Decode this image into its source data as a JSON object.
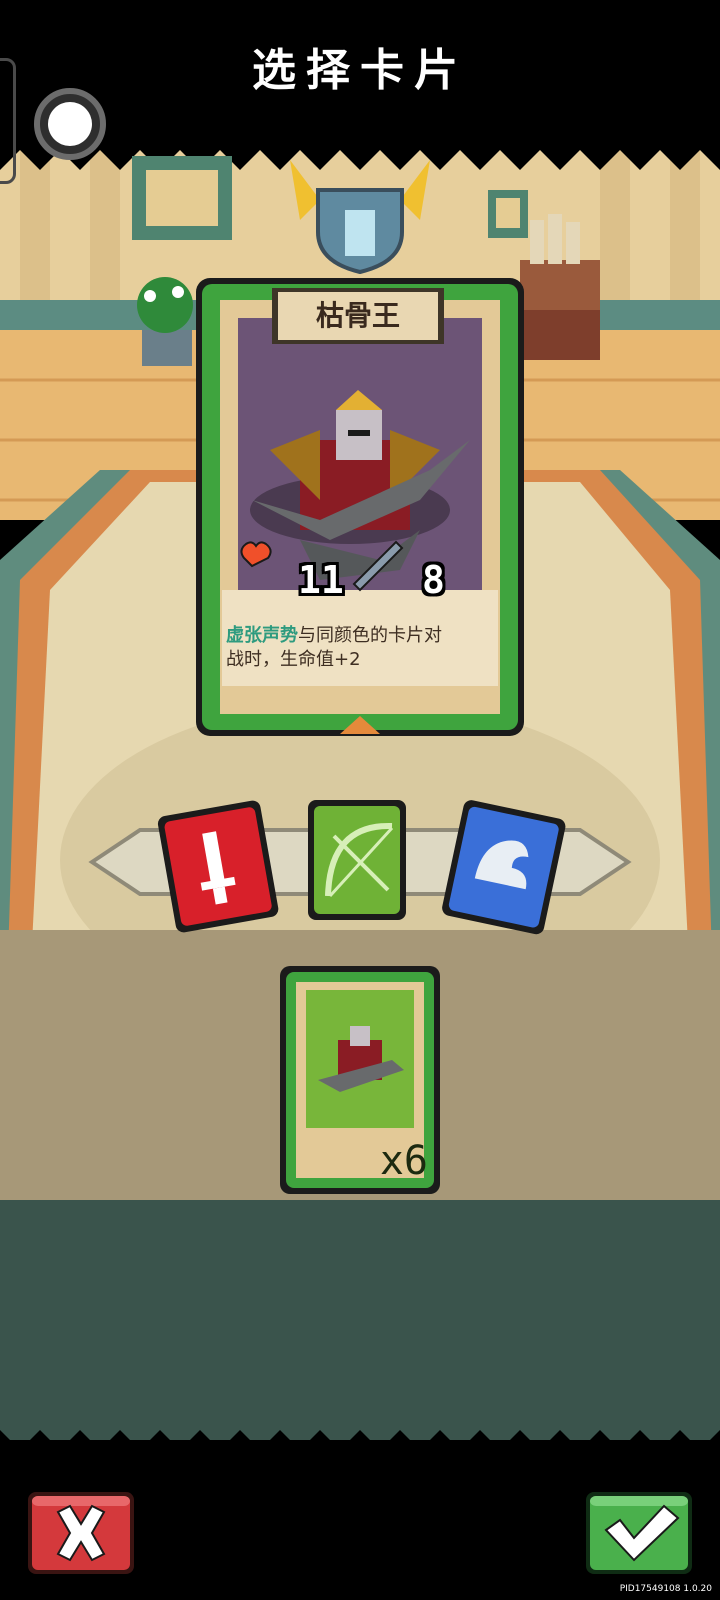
{
  "header": {
    "title": "选择卡片"
  },
  "card": {
    "name": "枯骨王",
    "health": "11",
    "attack": "8",
    "ability_keyword": "虚张声势",
    "ability_line1": "与同颜色的卡片对",
    "ability_line2": "战时，生命值+2"
  },
  "card_types": [
    {
      "label": "sword",
      "color": "#d8202a"
    },
    {
      "label": "bow",
      "color": "#6fb236"
    },
    {
      "label": "wing",
      "color": "#3a6fd8"
    }
  ],
  "deck": {
    "count": "x6"
  },
  "actions": {
    "cancel": "cancel",
    "confirm": "confirm"
  },
  "footer": {
    "pid": "PID17549108 1.0.20"
  },
  "icons": {
    "health": "heart-icon",
    "attack": "sword-icon",
    "cancel": "x-icon",
    "confirm": "check-icon"
  }
}
